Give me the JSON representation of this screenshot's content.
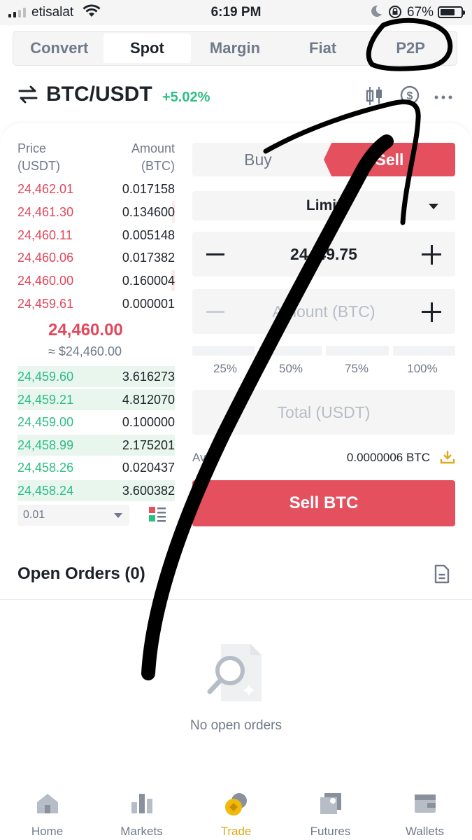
{
  "status_bar": {
    "carrier": "etisalat",
    "time": "6:19 PM",
    "battery": "67%"
  },
  "mode_tabs": [
    {
      "label": "Convert"
    },
    {
      "label": "Spot"
    },
    {
      "label": "Margin"
    },
    {
      "label": "Fiat"
    },
    {
      "label": "P2P"
    }
  ],
  "pair": {
    "symbol": "BTC/USDT",
    "change": "+5.02%"
  },
  "order_book": {
    "price_header": "Price\n(USDT)",
    "amount_header": "Amount\n(BTC)",
    "asks": [
      {
        "price": "24,462.01",
        "amount": "0.017158"
      },
      {
        "price": "24,461.30",
        "amount": "0.134600"
      },
      {
        "price": "24,460.11",
        "amount": "0.005148"
      },
      {
        "price": "24,460.06",
        "amount": "0.017382"
      },
      {
        "price": "24,460.00",
        "amount": "0.160004"
      },
      {
        "price": "24,459.61",
        "amount": "0.000001"
      }
    ],
    "mid_price": "24,460.00",
    "mid_usd": "≈ $24,460.00",
    "bids": [
      {
        "price": "24,459.60",
        "amount": "3.616273"
      },
      {
        "price": "24,459.21",
        "amount": "4.812070"
      },
      {
        "price": "24,459.00",
        "amount": "0.100000"
      },
      {
        "price": "24,458.99",
        "amount": "2.175201"
      },
      {
        "price": "24,458.26",
        "amount": "0.020437"
      },
      {
        "price": "24,458.24",
        "amount": "3.600382"
      }
    ],
    "depth": "0.01"
  },
  "order_form": {
    "buy_label": "Buy",
    "sell_label": "Sell",
    "order_type": "Limit",
    "price_value": "24449.75",
    "amount_placeholder": "Amount (BTC)",
    "percent_options": [
      "25%",
      "50%",
      "75%",
      "100%"
    ],
    "total_placeholder": "Total (USDT)",
    "avbl_label": "Avbl",
    "avbl_value": "0.0000006 BTC",
    "submit_label": "Sell BTC"
  },
  "open_orders": {
    "title": "Open Orders (0)",
    "empty_text": "No open orders"
  },
  "bottom_nav": [
    {
      "label": "Home"
    },
    {
      "label": "Markets"
    },
    {
      "label": "Trade"
    },
    {
      "label": "Futures"
    },
    {
      "label": "Wallets"
    }
  ],
  "colors": {
    "sell": "#e5505f",
    "buy": "#2ebd85",
    "accent": "#e0a81b"
  }
}
